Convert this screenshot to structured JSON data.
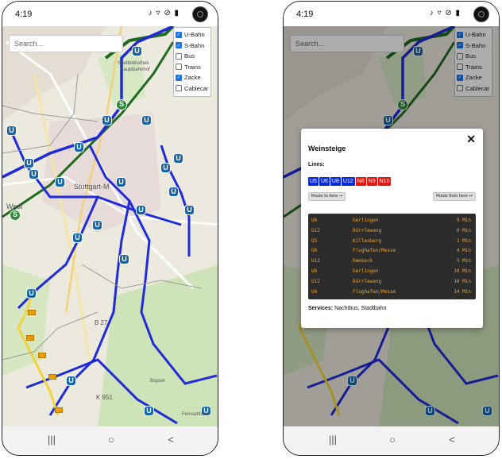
{
  "status": {
    "time": "4:19",
    "icons": "♪ ▿ ⊘ ▮"
  },
  "search": {
    "placeholder": "Search..."
  },
  "layers": [
    {
      "label": "U-Bahn",
      "checked": true
    },
    {
      "label": "S-Bahn",
      "checked": true
    },
    {
      "label": "Bus",
      "checked": false
    },
    {
      "label": "Trains",
      "checked": false
    },
    {
      "label": "Zacke",
      "checked": true
    },
    {
      "label": "Cablecar",
      "checked": false
    }
  ],
  "map_labels": {
    "stuttgart": "Stuttgart-M",
    "west": "West",
    "b27": "B 27",
    "k951": "K 951",
    "stadtbibliothek": "Stadtbibliothek",
    "hauptbahnhof": "Hauptbahnhof",
    "bopser": "Bopser",
    "fernsehturm": "Fernsehturm"
  },
  "badges": {
    "u": "U",
    "s": "S"
  },
  "navbar": {
    "recents": "|||",
    "home": "○",
    "back": "<"
  },
  "popup": {
    "stop_name": "Weinsteige",
    "close": "✕",
    "lines_label": "Lines:",
    "lines": [
      {
        "name": "U5",
        "color": "#0a2bd8"
      },
      {
        "name": "U6",
        "color": "#0a2bd8"
      },
      {
        "name": "U8",
        "color": "#0a2bd8"
      },
      {
        "name": "U12",
        "color": "#0a2bd8"
      },
      {
        "name": "N8",
        "color": "#e3170d"
      },
      {
        "name": "N9",
        "color": "#e3170d"
      },
      {
        "name": "N10",
        "color": "#e3170d"
      }
    ],
    "route_to": "Route to here ➙",
    "route_from": "Route from here ↦",
    "departures": [
      {
        "line": "U6",
        "destination": "Gerlingen",
        "time": "9 Min"
      },
      {
        "line": "U12",
        "destination": "Dürrlewang",
        "time": "0 Min"
      },
      {
        "line": "U5",
        "destination": "Killesberg",
        "time": "1 Min"
      },
      {
        "line": "U6",
        "destination": "Flughafen/Messe",
        "time": "4 Min"
      },
      {
        "line": "U12",
        "destination": "Remseck",
        "time": "5 Min"
      },
      {
        "line": "U6",
        "destination": "Gerlingen",
        "time": "10 Min"
      },
      {
        "line": "U12",
        "destination": "Dürrlewang",
        "time": "10 Min"
      },
      {
        "line": "U6",
        "destination": "Flughafen/Messe",
        "time": "14 Min"
      }
    ],
    "services_label": "Services:",
    "services": "Nachtbus, Stadtbahn"
  },
  "colors": {
    "ubahn": "#1f2bdb",
    "sbahn": "#1e6b1e",
    "zacke": "#f2d43a",
    "accent": "#1a73e8"
  }
}
